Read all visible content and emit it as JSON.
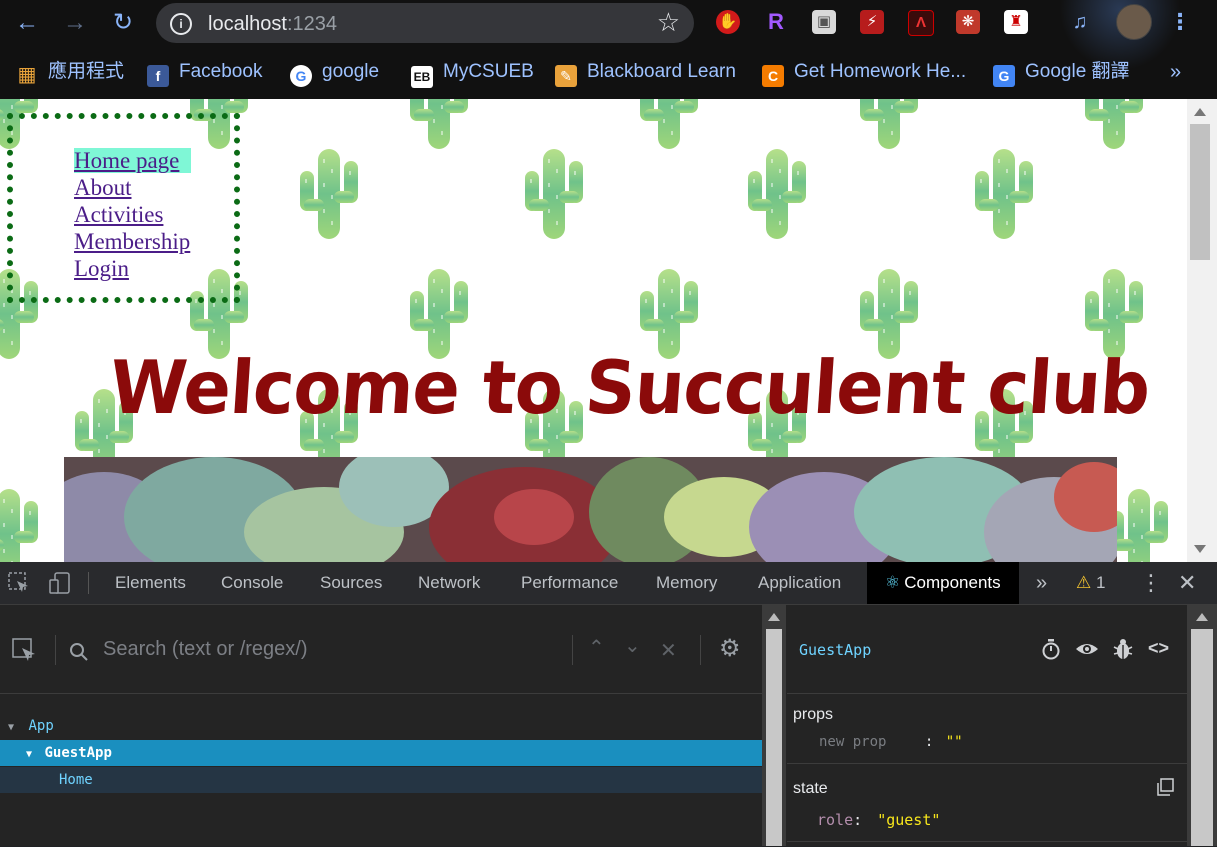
{
  "browser": {
    "url_host": "localhost",
    "url_port": ":1234",
    "bookmarks": [
      {
        "label": "應用程式",
        "icon": "apps-grid-icon"
      },
      {
        "label": "Facebook",
        "icon": "facebook-icon"
      },
      {
        "label": "google",
        "icon": "google-icon"
      },
      {
        "label": "MyCSUEB",
        "icon": "eb-icon"
      },
      {
        "label": "Blackboard Learn",
        "icon": "blackboard-icon"
      },
      {
        "label": "Get Homework He...",
        "icon": "chegg-icon"
      },
      {
        "label": "Google 翻譯",
        "icon": "google-translate-icon"
      }
    ],
    "overflow": "»"
  },
  "page": {
    "nav_links": [
      "Home page",
      "About",
      "Activities",
      "Membership",
      "Login"
    ],
    "heading": "Welcome to Succulent club"
  },
  "devtools": {
    "tabs": [
      "Elements",
      "Console",
      "Sources",
      "Network",
      "Performance",
      "Memory",
      "Application",
      "Components"
    ],
    "active_tab": "Components",
    "warning_count": "1",
    "search_placeholder": "Search (text or /regex/)",
    "tree": [
      {
        "label": "App",
        "level": 0
      },
      {
        "label": "GuestApp",
        "level": 1,
        "selected": true
      },
      {
        "label": "Home",
        "level": 2
      }
    ],
    "inspector": {
      "component": "GuestApp",
      "props_title": "props",
      "prop_key": "new prop",
      "prop_sep": ":",
      "prop_value": "\"\"",
      "state_title": "state",
      "state_key": "role",
      "state_sep": ":",
      "state_value": "\"guest\""
    }
  },
  "colors": {
    "heading": "#8b0a0a",
    "nav_active_bg": "#7ff7d6",
    "nav_border": "#0b6b15",
    "tree_selected": "#1a8fbf"
  }
}
